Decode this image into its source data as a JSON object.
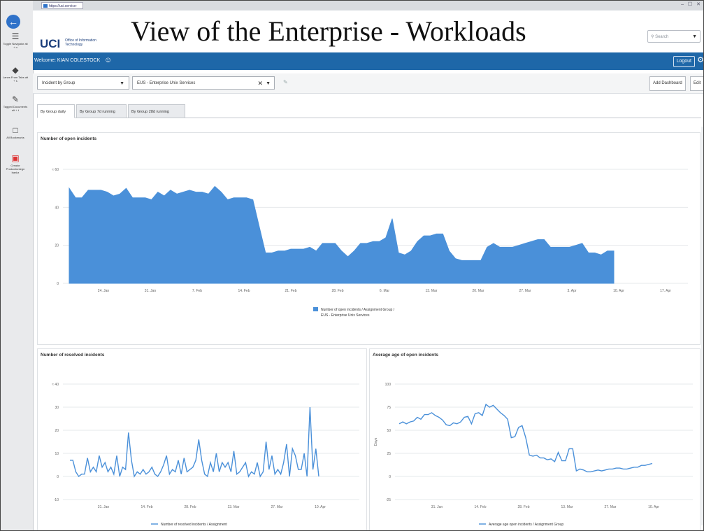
{
  "browser": {
    "address": "https://uci.service-now"
  },
  "window_controls": "– ☐ ✕",
  "header": {
    "slide_title": "View of the Enterprise - Workloads",
    "logo": "UCI",
    "logo_sub": "Office of Information Technology",
    "search_placeholder": "Search"
  },
  "topbar": {
    "welcome": "Welcome: KIAN COLESTOCK",
    "logout": "Logout"
  },
  "rail": {
    "items": [
      {
        "label": "Toggle Navigator alt + n",
        "icon": "navigator-icon"
      },
      {
        "label": "Lanes From Tabs alt + s",
        "icon": "lanes-icon"
      },
      {
        "label": "Tagged Documents alt + t",
        "icon": "tag-icon"
      },
      {
        "label": "All Bookmarks",
        "icon": "bookmark-icon"
      },
      {
        "label": "Creator Productionlegn bankz",
        "icon": "creator-icon"
      }
    ]
  },
  "filters": {
    "group_select": "Incident by Group",
    "group_value": "EUS - Enterprise Unix Services",
    "add_dashboard": "Add Dashboard",
    "edit": "Edit"
  },
  "tabs": [
    {
      "label": "By Group daily",
      "active": true
    },
    {
      "label": "By Group 7d running",
      "active": false
    },
    {
      "label": "By Group 28d running",
      "active": false
    }
  ],
  "colors": {
    "accent": "#1e67a8",
    "series": "#4a90d9"
  },
  "chart_data": [
    {
      "type": "area",
      "title": "Number of open incidents",
      "ylabel": "",
      "y_axis_prefix": "≈",
      "ylim": [
        0,
        60
      ],
      "yticks": [
        0,
        20,
        40,
        60
      ],
      "xticks": [
        "24. Jan",
        "31. Jan",
        "7. Feb",
        "14. Feb",
        "21. Feb",
        "28. Feb",
        "6. Mar",
        "13. Mar",
        "20. Mar",
        "27. Mar",
        "3. Apr",
        "10. Apr",
        "17. Apr"
      ],
      "series": [
        {
          "name": "Number of open incidents / Assignment Group / EUS - Enterprise Unix Services",
          "values": [
            50,
            45,
            45,
            49,
            49,
            49,
            48,
            46,
            47,
            50,
            45,
            45,
            45,
            44,
            48,
            46,
            49,
            47,
            48,
            49,
            48,
            48,
            47,
            51,
            48,
            44,
            45,
            45,
            45,
            44,
            30,
            16,
            16,
            17,
            17,
            18,
            18,
            18,
            19,
            17,
            21,
            21,
            21,
            17,
            14,
            17,
            21,
            21,
            22,
            22,
            24,
            34,
            16,
            15,
            17,
            22,
            25,
            25,
            26,
            26,
            17,
            13,
            12,
            12,
            12,
            12,
            19,
            21,
            19,
            19,
            19,
            20,
            21,
            22,
            23,
            23,
            19,
            19,
            19,
            19,
            20,
            21,
            16,
            16,
            15,
            17,
            17
          ]
        }
      ]
    },
    {
      "type": "line",
      "title": "Number of resolved incidents",
      "y_axis_prefix": "≈",
      "ylim": [
        -10,
        40
      ],
      "yticks": [
        -10,
        0,
        10,
        20,
        30,
        40
      ],
      "xticks": [
        "31. Jan",
        "14. Feb",
        "28. Feb",
        "13. Mar",
        "27. Mar",
        "10. Apr"
      ],
      "series": [
        {
          "name": "Number of resolved incidents / Assignment",
          "values": [
            7,
            7,
            2,
            0,
            1,
            1,
            8,
            2,
            4,
            2,
            9,
            4,
            6,
            2,
            4,
            1,
            9,
            0,
            4,
            3,
            19,
            7,
            0,
            2,
            1,
            3,
            1,
            2,
            4,
            1,
            0,
            2,
            5,
            9,
            1,
            3,
            2,
            7,
            1,
            8,
            2,
            3,
            4,
            7,
            16,
            7,
            1,
            0,
            6,
            2,
            10,
            2,
            6,
            4,
            6,
            2,
            11,
            1,
            2,
            4,
            6,
            0,
            2,
            1,
            6,
            0,
            2,
            15,
            3,
            9,
            1,
            3,
            1,
            6,
            14,
            0,
            12,
            9,
            3,
            3,
            10,
            0,
            30,
            3,
            12,
            0
          ]
        }
      ]
    },
    {
      "type": "line",
      "title": "Average age of open incidents",
      "ylabel": "Days",
      "ylim": [
        -25,
        100
      ],
      "yticks": [
        -25,
        0,
        25,
        50,
        75,
        100
      ],
      "xticks": [
        "31. Jan",
        "14. Feb",
        "28. Feb",
        "13. Mar",
        "27. Mar",
        "10. Apr"
      ],
      "series": [
        {
          "name": "Average age open incidents / Assignment Group",
          "values": [
            57,
            59,
            57,
            59,
            60,
            64,
            62,
            67,
            67,
            69,
            66,
            64,
            61,
            56,
            55,
            58,
            57,
            59,
            64,
            65,
            57,
            68,
            69,
            66,
            78,
            75,
            77,
            73,
            69,
            66,
            62,
            42,
            43,
            53,
            55,
            42,
            23,
            22,
            23,
            20,
            20,
            18,
            19,
            16,
            26,
            17,
            17,
            30,
            30,
            6,
            8,
            7,
            5,
            5,
            6,
            7,
            6,
            7,
            8,
            8,
            9,
            9,
            8,
            8,
            9,
            10,
            10,
            12,
            12,
            13,
            14
          ]
        }
      ]
    }
  ]
}
